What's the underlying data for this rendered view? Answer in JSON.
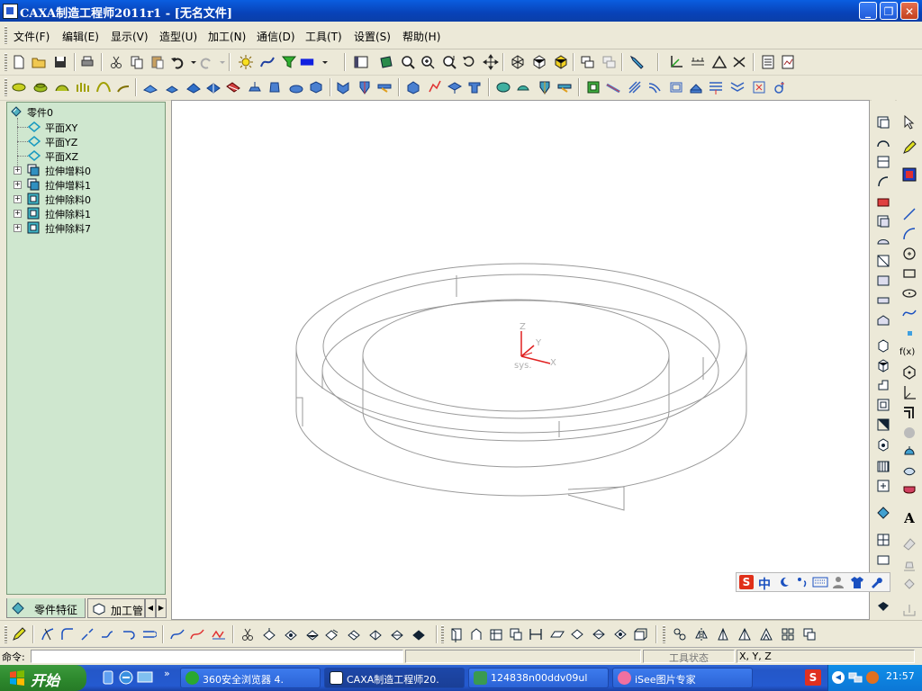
{
  "window": {
    "title": "CAXA制造工程师2011r1 - [无名文件]",
    "minimize": "_",
    "restore": "❐",
    "close": "✕"
  },
  "menu": {
    "items": [
      "文件(F)",
      "编辑(E)",
      "显示(V)",
      "造型(U)",
      "加工(N)",
      "通信(D)",
      "工具(T)",
      "设置(S)",
      "帮助(H)"
    ]
  },
  "tree": {
    "root": "零件0",
    "planes": [
      "平面XY",
      "平面YZ",
      "平面XZ"
    ],
    "features": [
      "拉伸增料0",
      "拉伸增料1",
      "拉伸除料0",
      "拉伸除料1",
      "拉伸除料7"
    ],
    "expand_symbol": "+"
  },
  "tabs": {
    "part": "零件特征",
    "machining": "加工管",
    "prev": "◀",
    "next": "▶"
  },
  "axes": {
    "x": "X",
    "y": "Y",
    "z": "Z",
    "origin": "sys."
  },
  "status": {
    "command_label": "命令:",
    "tool_state": "工具状态",
    "coords": "X, Y, Z"
  },
  "right_toolbar": {
    "fx_label": "f(x)",
    "text_tool": "A"
  },
  "ime": {
    "logo": "S",
    "mode": "中"
  },
  "taskbar": {
    "start": "开始",
    "tasks": [
      "360安全浏览器 4.",
      "CAXA制造工程师20.",
      "124838n00ddv09ul",
      "iSee图片专家"
    ],
    "quick_more": "»",
    "time": "21:57",
    "tray_arrow": "◀"
  },
  "colors": {
    "tree_bg": "#cfe7cf",
    "title_blue": "#0a5ee0",
    "taskbar_blue": "#245ad0",
    "start_green": "#2e8a2e",
    "axis_red": "#e02020"
  }
}
